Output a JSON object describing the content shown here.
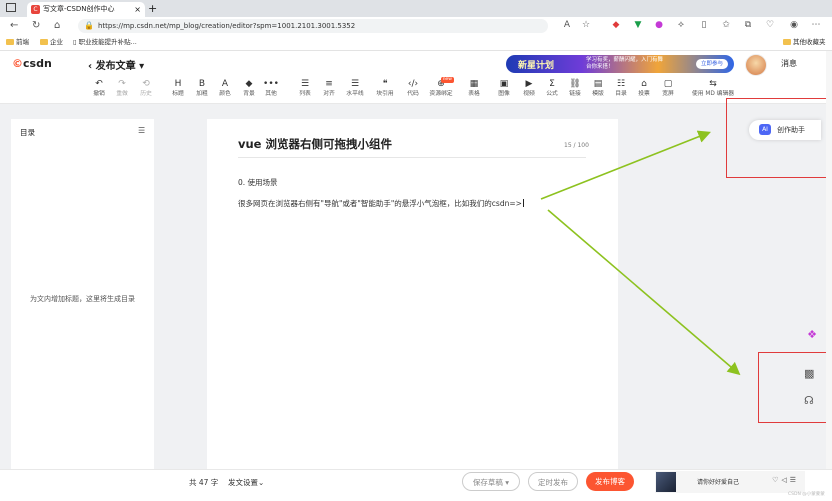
{
  "browser": {
    "tab_title": "写文章-CSDN创作中心",
    "tab_close": "×",
    "new_tab": "+",
    "url": "https://mp.csdn.net/mp_blog/creation/editor?spm=1001.2101.3001.5352",
    "bookmarks": [
      {
        "label": "前端"
      },
      {
        "label": "企业"
      },
      {
        "label": "职业技能提升补贴..."
      }
    ],
    "other_bookmarks": "其他收藏夹"
  },
  "header": {
    "logo": "csdn",
    "back": "‹",
    "publish_title": "发布文章 ▾",
    "banner": {
      "title": "新星计划",
      "text": "学习有奖，薪酬闪耀，入门有舞台你来搭！",
      "button": "立即参与"
    },
    "messages": "消息"
  },
  "toolbar": {
    "items": [
      {
        "label": "撤销",
        "icon": "↶",
        "disabled": false
      },
      {
        "label": "重做",
        "icon": "↷",
        "disabled": true
      },
      {
        "label": "历史",
        "icon": "⟲",
        "disabled": true
      },
      {
        "label": "标题",
        "icon": "H",
        "disabled": false
      },
      {
        "label": "加粗",
        "icon": "B",
        "disabled": false
      },
      {
        "label": "颜色",
        "icon": "A",
        "disabled": false
      },
      {
        "label": "背景",
        "icon": "◆",
        "disabled": false
      },
      {
        "label": "其他",
        "icon": "•••",
        "disabled": false
      },
      {
        "label": "列表",
        "icon": "☰",
        "disabled": false
      },
      {
        "label": "对齐",
        "icon": "≡",
        "disabled": false
      },
      {
        "label": "水平线",
        "icon": "☰",
        "disabled": false
      },
      {
        "label": "块引用",
        "icon": "❝",
        "disabled": false
      },
      {
        "label": "代码",
        "icon": "‹/›",
        "disabled": false
      },
      {
        "label": "资源绑定",
        "icon": "⊕",
        "disabled": false,
        "badge": "new"
      },
      {
        "label": "表格",
        "icon": "▦",
        "disabled": false
      },
      {
        "label": "图像",
        "icon": "▣",
        "disabled": false
      },
      {
        "label": "视频",
        "icon": "▶",
        "disabled": false
      },
      {
        "label": "公式",
        "icon": "Σ",
        "disabled": false
      },
      {
        "label": "链接",
        "icon": "⛓",
        "disabled": false
      },
      {
        "label": "模版",
        "icon": "▤",
        "disabled": false
      },
      {
        "label": "目录",
        "icon": "☷",
        "disabled": false
      },
      {
        "label": "投票",
        "icon": "⌂",
        "disabled": false
      },
      {
        "label": "宽屏",
        "icon": "▢",
        "disabled": false
      },
      {
        "label": "使用 MD 编辑器",
        "icon": "⇆",
        "disabled": false
      }
    ]
  },
  "sidebar": {
    "title": "目录",
    "icon": "☰",
    "empty_text": "为文内增加标题，这里将生成目录"
  },
  "editor": {
    "title": "vue 浏览器右侧可拖拽小组件",
    "counter": "15 / 100",
    "paragraphs": [
      "0. 使用场景",
      "很多网页在浏览器右侧有\"导航\"或者\"智能助手\"的悬浮小气泡框，比如我们的csdn=>"
    ]
  },
  "float": {
    "assistant": "创作助手",
    "bot_icon": "AI"
  },
  "bottom": {
    "word_count": "共 47 字",
    "settings": "发文设置",
    "save_draft": "保存草稿 ▾",
    "timed_publish": "定时发布",
    "publish": "发布博客",
    "music_song": "请你好好爱自己",
    "watermark": "CSDN @小蒙蒙蒙"
  },
  "colors": {
    "brand": "#fc5531",
    "arrow": "#8dc21f",
    "highlight": "#e03b3b"
  }
}
